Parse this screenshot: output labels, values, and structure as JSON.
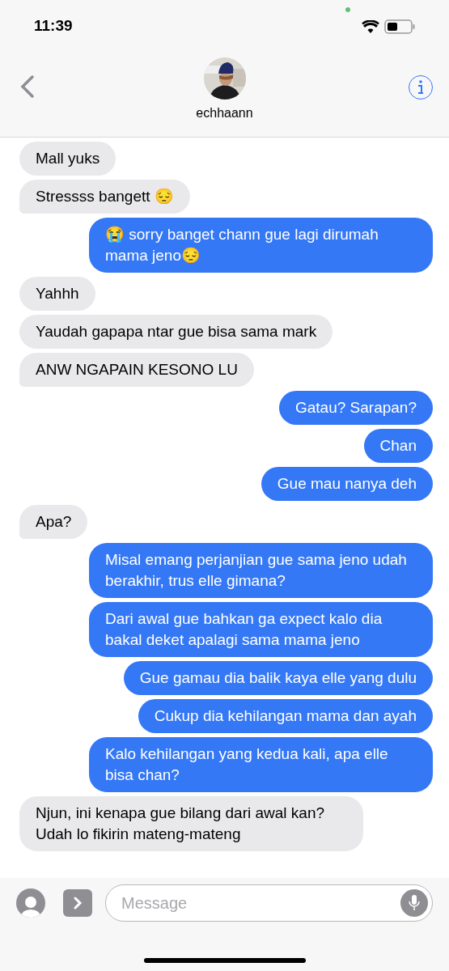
{
  "status_bar": {
    "time": "11:39"
  },
  "header": {
    "contact_name": "echhaann"
  },
  "messages": [
    {
      "kind": "received",
      "text": "Mall yuks",
      "tail": false
    },
    {
      "kind": "received",
      "text": "Stressss bangett 😔",
      "tail": true
    },
    {
      "kind": "sent",
      "text": "😭 sorry banget chann gue lagi dirumah mama jeno😔",
      "tail": false
    },
    {
      "kind": "received",
      "text": "Yahhh",
      "tail": false
    },
    {
      "kind": "received",
      "text": "Yaudah gapapa ntar gue bisa sama mark",
      "tail": false
    },
    {
      "kind": "received",
      "text": "ANW NGAPAIN KESONO LU",
      "tail": true
    },
    {
      "kind": "sent",
      "text": "Gatau? Sarapan?",
      "tail": false
    },
    {
      "kind": "sent",
      "text": "Chan",
      "tail": false
    },
    {
      "kind": "sent",
      "text": "Gue mau nanya deh",
      "tail": false
    },
    {
      "kind": "received",
      "text": "Apa?",
      "tail": true
    },
    {
      "kind": "sent",
      "text": "Misal emang perjanjian gue sama jeno udah berakhir, trus elle gimana?",
      "tail": false
    },
    {
      "kind": "sent",
      "text": "Dari awal gue bahkan ga expect kalo dia bakal deket apalagi sama mama jeno",
      "tail": false
    },
    {
      "kind": "sent",
      "text": "Gue gamau dia balik kaya elle yang dulu",
      "tail": false
    },
    {
      "kind": "sent",
      "text": "Cukup dia kehilangan mama dan ayah",
      "tail": false
    },
    {
      "kind": "sent",
      "text": "Kalo kehilangan yang kedua kali, apa elle bisa chan?",
      "tail": false
    },
    {
      "kind": "received",
      "text": "Njun, ini kenapa gue bilang dari awal kan? Udah lo fikirin mateng-mateng",
      "tail": false
    }
  ],
  "composer": {
    "placeholder": "Message"
  }
}
